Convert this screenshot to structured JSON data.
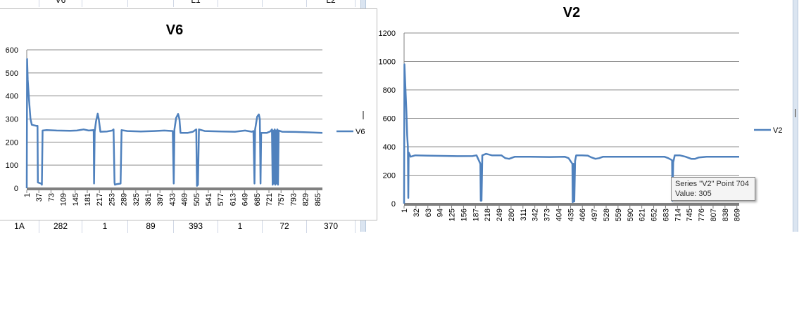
{
  "header_cells": {
    "left": "V6",
    "mid": "L1",
    "right": "L2"
  },
  "row_cells": [
    "1A",
    "282",
    "1",
    "89",
    "393",
    "1",
    "72",
    "370"
  ],
  "tooltip": {
    "line1": "Series \"V2\" Point 704",
    "line2": "Value: 305"
  },
  "colors": {
    "series": "#4f81bd",
    "axis": "#808080",
    "grid": "#8c8c8c"
  },
  "chart_data": [
    {
      "type": "line",
      "title": "V6",
      "legend_position": "right",
      "grid": true,
      "ylim": [
        0,
        600
      ],
      "yticks": [
        0,
        100,
        200,
        300,
        400,
        500,
        600
      ],
      "xlim": [
        1,
        880
      ],
      "xtick_labels": [
        "1",
        "37",
        "73",
        "109",
        "145",
        "181",
        "217",
        "253",
        "289",
        "325",
        "361",
        "397",
        "433",
        "469",
        "505",
        "541",
        "577",
        "613",
        "649",
        "685",
        "721",
        "757",
        "793",
        "829",
        "865"
      ],
      "series": [
        {
          "name": "V6",
          "points": [
            [
              1,
              0
            ],
            [
              2,
              560
            ],
            [
              4,
              470
            ],
            [
              8,
              380
            ],
            [
              12,
              300
            ],
            [
              16,
              275
            ],
            [
              30,
              270
            ],
            [
              33,
              270
            ],
            [
              34,
              25
            ],
            [
              40,
              22
            ],
            [
              44,
              20
            ],
            [
              46,
              15
            ],
            [
              48,
              250
            ],
            [
              60,
              252
            ],
            [
              90,
              250
            ],
            [
              130,
              249
            ],
            [
              150,
              250
            ],
            [
              170,
              255
            ],
            [
              185,
              250
            ],
            [
              200,
              252
            ],
            [
              201,
              20
            ],
            [
              203,
              245
            ],
            [
              207,
              290
            ],
            [
              212,
              323
            ],
            [
              215,
              300
            ],
            [
              220,
              245
            ],
            [
              240,
              246
            ],
            [
              255,
              250
            ],
            [
              259,
              255
            ],
            [
              262,
              25
            ],
            [
              263,
              15
            ],
            [
              270,
              18
            ],
            [
              280,
              20
            ],
            [
              283,
              252
            ],
            [
              300,
              248
            ],
            [
              340,
              246
            ],
            [
              380,
              248
            ],
            [
              410,
              250
            ],
            [
              435,
              248
            ],
            [
              438,
              20
            ],
            [
              440,
              255
            ],
            [
              445,
              305
            ],
            [
              451,
              322
            ],
            [
              455,
              300
            ],
            [
              458,
              240
            ],
            [
              480,
              240
            ],
            [
              495,
              245
            ],
            [
              505,
              255
            ],
            [
              507,
              10
            ],
            [
              510,
              15
            ],
            [
              513,
              255
            ],
            [
              530,
              248
            ],
            [
              580,
              246
            ],
            [
              620,
              245
            ],
            [
              650,
              250
            ],
            [
              670,
              245
            ],
            [
              675,
              248
            ],
            [
              678,
              20
            ],
            [
              680,
              255
            ],
            [
              686,
              310
            ],
            [
              691,
              320
            ],
            [
              694,
              300
            ],
            [
              696,
              20
            ],
            [
              698,
              240
            ],
            [
              715,
              240
            ],
            [
              725,
              246
            ],
            [
              730,
              255
            ],
            [
              732,
              15
            ],
            [
              734,
              250
            ],
            [
              736,
              20
            ],
            [
              738,
              255
            ],
            [
              740,
              15
            ],
            [
              742,
              250
            ],
            [
              744,
              20
            ],
            [
              746,
              255
            ],
            [
              748,
              15
            ],
            [
              750,
              250
            ],
            [
              760,
              245
            ],
            [
              800,
              244
            ],
            [
              840,
              242
            ],
            [
              880,
              240
            ]
          ]
        }
      ]
    },
    {
      "type": "line",
      "title": "V2",
      "legend_position": "right",
      "grid": true,
      "ylim": [
        0,
        1200
      ],
      "yticks": [
        0,
        200,
        400,
        600,
        800,
        1000,
        1200
      ],
      "xlim": [
        1,
        875
      ],
      "xtick_labels": [
        "1",
        "32",
        "63",
        "94",
        "125",
        "156",
        "187",
        "218",
        "249",
        "280",
        "311",
        "342",
        "373",
        "404",
        "435",
        "466",
        "497",
        "528",
        "559",
        "590",
        "621",
        "652",
        "683",
        "714",
        "745",
        "776",
        "807",
        "838",
        "869"
      ],
      "series": [
        {
          "name": "V2",
          "points": [
            [
              1,
              0
            ],
            [
              2,
              980
            ],
            [
              4,
              850
            ],
            [
              7,
              650
            ],
            [
              9,
              480
            ],
            [
              11,
              400
            ],
            [
              12,
              40
            ],
            [
              13,
              360
            ],
            [
              18,
              330
            ],
            [
              30,
              340
            ],
            [
              60,
              338
            ],
            [
              100,
              336
            ],
            [
              140,
              334
            ],
            [
              180,
              335
            ],
            [
              190,
              340
            ],
            [
              200,
              280
            ],
            [
              201,
              20
            ],
            [
              203,
              20
            ],
            [
              205,
              340
            ],
            [
              215,
              350
            ],
            [
              230,
              340
            ],
            [
              255,
              340
            ],
            [
              265,
              320
            ],
            [
              275,
              315
            ],
            [
              290,
              330
            ],
            [
              330,
              330
            ],
            [
              380,
              328
            ],
            [
              420,
              330
            ],
            [
              430,
              320
            ],
            [
              440,
              280
            ],
            [
              441,
              10
            ],
            [
              443,
              280
            ],
            [
              445,
              15
            ],
            [
              447,
              300
            ],
            [
              450,
              340
            ],
            [
              465,
              340
            ],
            [
              480,
              338
            ],
            [
              490,
              325
            ],
            [
              500,
              315
            ],
            [
              510,
              320
            ],
            [
              520,
              330
            ],
            [
              560,
              330
            ],
            [
              620,
              330
            ],
            [
              660,
              330
            ],
            [
              680,
              330
            ],
            [
              690,
              320
            ],
            [
              700,
              305
            ],
            [
              701,
              20
            ],
            [
              703,
              290
            ],
            [
              707,
              340
            ],
            [
              720,
              340
            ],
            [
              735,
              330
            ],
            [
              750,
              315
            ],
            [
              760,
              315
            ],
            [
              770,
              325
            ],
            [
              790,
              330
            ],
            [
              830,
              330
            ],
            [
              850,
              330
            ],
            [
              875,
              330
            ]
          ]
        }
      ]
    }
  ]
}
